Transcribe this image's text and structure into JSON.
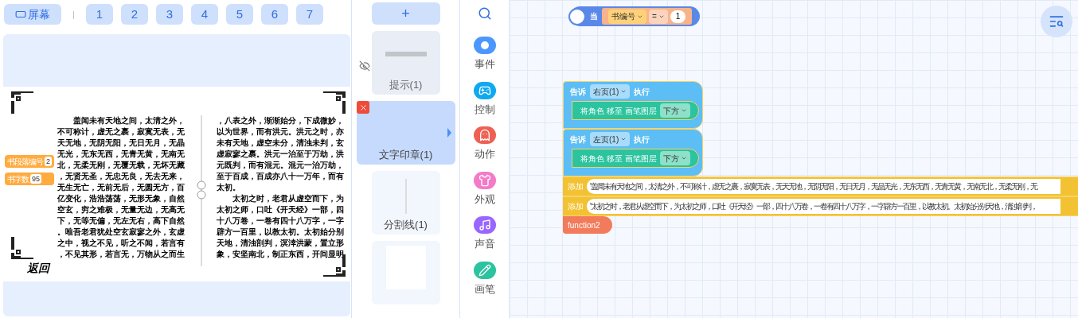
{
  "top_bar": {
    "screen_button": "屏幕",
    "separator": "|",
    "pages": [
      "1",
      "2",
      "3",
      "4",
      "5",
      "6",
      "7"
    ]
  },
  "book": {
    "badges": [
      {
        "label": "书段落编号",
        "value": "2"
      },
      {
        "label": "书字数",
        "value": "95"
      }
    ],
    "left_page": [
      {
        "text": "盖闻未有天地之间，太清之外，",
        "indent": true
      },
      {
        "text": "不可称计，虚无之裹，寂寞无表，无",
        "indent": false
      },
      {
        "text": "天无地，无阴无阳，无日无月，无晶",
        "indent": false
      },
      {
        "text": "无光，无东无西，无青无黄，无南无",
        "indent": false
      },
      {
        "text": "北，无柔无刚，无覆无载，无坏无藏",
        "indent": false
      },
      {
        "text": "，无贤无圣，无忠无良，无去无来，",
        "indent": false
      },
      {
        "text": "无生无亡，无前无后，无圆无方，百",
        "indent": false
      },
      {
        "text": "亿变化，浩浩荡荡，无形无象，自然",
        "indent": false
      },
      {
        "text": "空玄，穷之难极，无量无边，无高无",
        "indent": false
      },
      {
        "text": "下，无等无偏，无左无右，高下自然",
        "indent": false
      },
      {
        "text": "。唯吾老君犹处空玄寂寥之外，玄虚",
        "indent": false
      },
      {
        "text": "之中，视之不见，听之不闻，若言有",
        "indent": false
      },
      {
        "text": "，不见其形，若言无，万物从之而生",
        "indent": false
      }
    ],
    "right_page": [
      {
        "text": "，八表之外，渐渐始分，下成微妙，",
        "indent": false
      },
      {
        "text": "以为世界，而有洪元。洪元之时，亦",
        "indent": false
      },
      {
        "text": "未有天地，虚空未分，清浊未判，玄",
        "indent": false
      },
      {
        "text": "虚寂寥之裹。洪元一治至于万劫，洪",
        "indent": false
      },
      {
        "text": "元既判，而有混元。混元一治万劫，",
        "indent": false
      },
      {
        "text": "至于百成，百成亦八十一万年，而有",
        "indent": false
      },
      {
        "text": "太初。",
        "indent": false
      },
      {
        "text": "太初之时，老君从虚空而下，为",
        "indent": true
      },
      {
        "text": "太初之师，口吐《开天经》一部，四",
        "indent": false
      },
      {
        "text": "十八万卷，一卷有四十八万字，一字",
        "indent": false
      },
      {
        "text": "辟方一百里，以教太初。太初始分别",
        "indent": false
      },
      {
        "text": "天地，清浊剖判，溟涬洪蒙，置立形",
        "indent": false
      },
      {
        "text": "象，安坚南北，制正东西，开间显明",
        "indent": false
      }
    ],
    "back_label": "返回"
  },
  "layers": {
    "add_button": "+",
    "items": [
      {
        "kind": "image",
        "label": "提示(1)",
        "hidden": true,
        "selected": false
      },
      {
        "kind": "stamp",
        "label": "文字印章(1)",
        "hidden": false,
        "selected": true
      },
      {
        "kind": "divider",
        "label": "分割线(1)",
        "hidden": false,
        "selected": false
      },
      {
        "kind": "blank",
        "hidden": false,
        "selected": false
      }
    ]
  },
  "categories": [
    {
      "label": "事件",
      "color": "#4c97ff"
    },
    {
      "label": "控制",
      "color": "#0fa9f0"
    },
    {
      "label": "动作",
      "color": "#ef6054"
    },
    {
      "label": "外观",
      "color": "#f47ac8"
    },
    {
      "label": "声音",
      "color": "#9966ff"
    },
    {
      "label": "画笔",
      "color": "#2cc39f"
    }
  ],
  "hat_block": {
    "label": "当",
    "variable": "书编号",
    "operator": "=",
    "value": "1"
  },
  "blocks": [
    {
      "kind": "tell",
      "label": "告诉",
      "target": "右页(1)",
      "action": "执行",
      "inner": {
        "label": "将角色 移至 画笔图层",
        "option": "下方"
      }
    },
    {
      "kind": "tell",
      "label": "告诉",
      "target": "左页(1)",
      "action": "执行",
      "inner": {
        "label": "将角色 移至 画笔图层",
        "option": "下方"
      }
    },
    {
      "kind": "add",
      "label": "添加",
      "text": "“盖闻未有天地之间，太清之外，不可称计，虚无之裹，寂寞无表，无天无地，无阴无阳，无日无月，无晶无光，无东无西，无青无黄，无南无北，无柔无刚，无"
    },
    {
      "kind": "add",
      "label": "添加",
      "text": "“太初之时，老君从虚空而下，为太初之师，口吐《开天经》一部，四十八万卷，一卷有四十八万字，一字辟方一百里，以教太初。太初始分别天地，清浊剖判，"
    },
    {
      "kind": "call",
      "label": "function2"
    }
  ]
}
